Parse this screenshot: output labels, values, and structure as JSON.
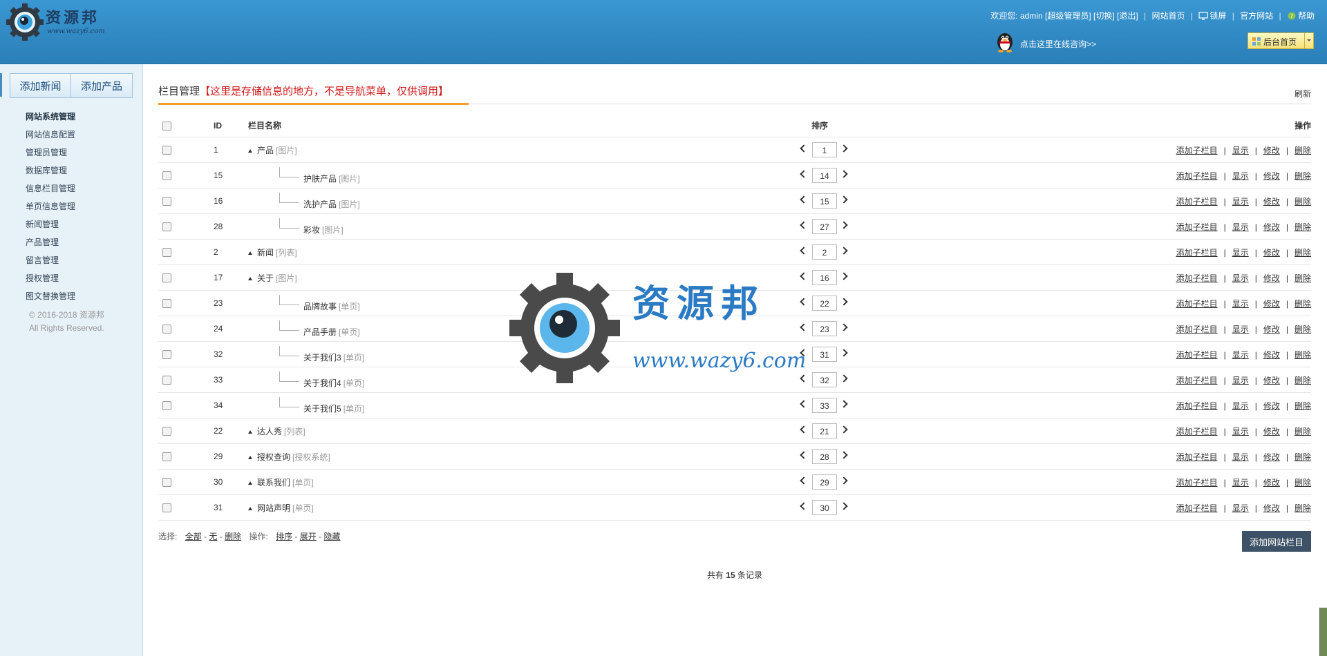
{
  "header": {
    "logo_text": "资源邦",
    "logo_url": "www.wazy6.com",
    "welcome": "欢迎您:",
    "user": "admin",
    "role": "[超级管理员]",
    "switch": "[切换]",
    "logout": "[退出]",
    "site_home": "网站首页",
    "lock": "锁屏",
    "official": "官方网站",
    "help": "帮助",
    "qq_consult": "点击这里在线咨询>>",
    "backend_home": "后台首页"
  },
  "sidebar": {
    "quick_add_news": "添加新闻",
    "quick_add_product": "添加产品",
    "menu_head": "网站系统管理",
    "items": [
      "网站信息配置",
      "管理员管理",
      "数据库管理",
      "信息栏目管理",
      "单页信息管理",
      "新闻管理",
      "产品管理",
      "留言管理",
      "授权管理",
      "图文替换管理"
    ],
    "copyright1": "© 2016-2018 资源邦",
    "copyright2": "All Rights Reserved."
  },
  "main": {
    "title": "栏目管理",
    "title_note": "【这里是存储信息的地方，不是导航菜单，仅供调用】",
    "refresh": "刷新",
    "columns": {
      "id": "ID",
      "name": "栏目名称",
      "sort": "排序",
      "ops": "操作"
    },
    "op_labels": {
      "add_child": "添加子栏目",
      "show": "显示",
      "edit": "修改",
      "delete": "删除"
    },
    "rows": [
      {
        "id": "1",
        "name": "产品",
        "tag": "[图片]",
        "level": 0,
        "sort": "1"
      },
      {
        "id": "15",
        "name": "护肤产品",
        "tag": "[图片]",
        "level": 1,
        "sort": "14"
      },
      {
        "id": "16",
        "name": "洗护产品",
        "tag": "[图片]",
        "level": 1,
        "sort": "15"
      },
      {
        "id": "28",
        "name": "彩妆",
        "tag": "[图片]",
        "level": 1,
        "sort": "27"
      },
      {
        "id": "2",
        "name": "新闻",
        "tag": "[列表]",
        "level": 0,
        "sort": "2"
      },
      {
        "id": "17",
        "name": "关于",
        "tag": "[图片]",
        "level": 0,
        "sort": "16"
      },
      {
        "id": "23",
        "name": "品牌故事",
        "tag": "[单页]",
        "level": 1,
        "sort": "22"
      },
      {
        "id": "24",
        "name": "产品手册",
        "tag": "[单页]",
        "level": 1,
        "sort": "23"
      },
      {
        "id": "32",
        "name": "关于我们3",
        "tag": "[单页]",
        "level": 1,
        "sort": "31"
      },
      {
        "id": "33",
        "name": "关于我们4",
        "tag": "[单页]",
        "level": 1,
        "sort": "32"
      },
      {
        "id": "34",
        "name": "关于我们5",
        "tag": "[单页]",
        "level": 1,
        "sort": "33"
      },
      {
        "id": "22",
        "name": "达人秀",
        "tag": "[列表]",
        "level": 0,
        "sort": "21"
      },
      {
        "id": "29",
        "name": "授权查询",
        "tag": "[授权系统]",
        "level": 0,
        "sort": "28"
      },
      {
        "id": "30",
        "name": "联系我们",
        "tag": "[单页]",
        "level": 0,
        "sort": "29"
      },
      {
        "id": "31",
        "name": "网站声明",
        "tag": "[单页]",
        "level": 0,
        "sort": "30"
      }
    ],
    "footer": {
      "select_label": "选择:",
      "all": "全部",
      "none": "无",
      "delete": "删除",
      "op_label": "操作:",
      "sort": "排序",
      "expand": "展开",
      "hide": "隐藏",
      "add_button": "添加网站栏目",
      "total_prefix": "共有",
      "total": "15",
      "total_suffix": "条记录"
    }
  },
  "watermark": {
    "text": "资源邦",
    "url": "www.wazy6.com"
  },
  "colors": {
    "header": "#2f88c6",
    "accent": "#f59b2b",
    "note_red": "#d01717",
    "button_dark": "#3d5266"
  }
}
